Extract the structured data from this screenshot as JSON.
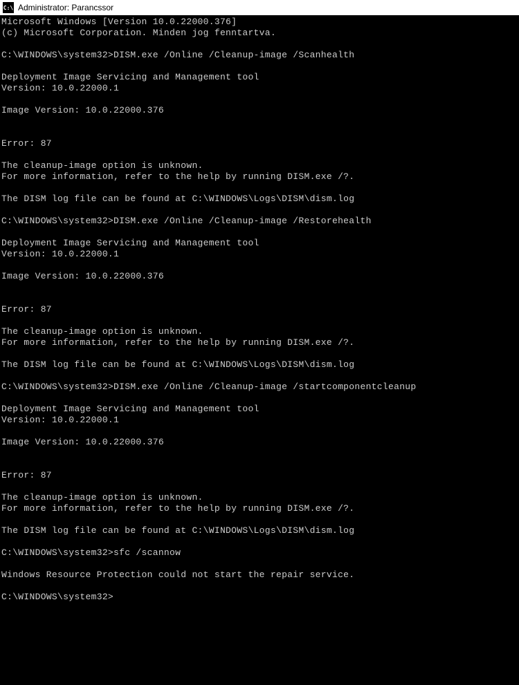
{
  "titlebar": {
    "icon_label": "C:\\",
    "text": "Administrator: Parancssor"
  },
  "lines": [
    "Microsoft Windows [Version 10.0.22000.376]",
    "(c) Microsoft Corporation. Minden jog fenntartva.",
    "",
    "C:\\WINDOWS\\system32>DISM.exe /Online /Cleanup-image /Scanhealth",
    "",
    "Deployment Image Servicing and Management tool",
    "Version: 10.0.22000.1",
    "",
    "Image Version: 10.0.22000.376",
    "",
    "",
    "Error: 87",
    "",
    "The cleanup-image option is unknown.",
    "For more information, refer to the help by running DISM.exe /?.",
    "",
    "The DISM log file can be found at C:\\WINDOWS\\Logs\\DISM\\dism.log",
    "",
    "C:\\WINDOWS\\system32>DISM.exe /Online /Cleanup-image /Restorehealth",
    "",
    "Deployment Image Servicing and Management tool",
    "Version: 10.0.22000.1",
    "",
    "Image Version: 10.0.22000.376",
    "",
    "",
    "Error: 87",
    "",
    "The cleanup-image option is unknown.",
    "For more information, refer to the help by running DISM.exe /?.",
    "",
    "The DISM log file can be found at C:\\WINDOWS\\Logs\\DISM\\dism.log",
    "",
    "C:\\WINDOWS\\system32>DISM.exe /Online /Cleanup-image /startcomponentcleanup",
    "",
    "Deployment Image Servicing and Management tool",
    "Version: 10.0.22000.1",
    "",
    "Image Version: 10.0.22000.376",
    "",
    "",
    "Error: 87",
    "",
    "The cleanup-image option is unknown.",
    "For more information, refer to the help by running DISM.exe /?.",
    "",
    "The DISM log file can be found at C:\\WINDOWS\\Logs\\DISM\\dism.log",
    "",
    "C:\\WINDOWS\\system32>sfc /scannow",
    "",
    "Windows Resource Protection could not start the repair service.",
    "",
    "C:\\WINDOWS\\system32>"
  ]
}
